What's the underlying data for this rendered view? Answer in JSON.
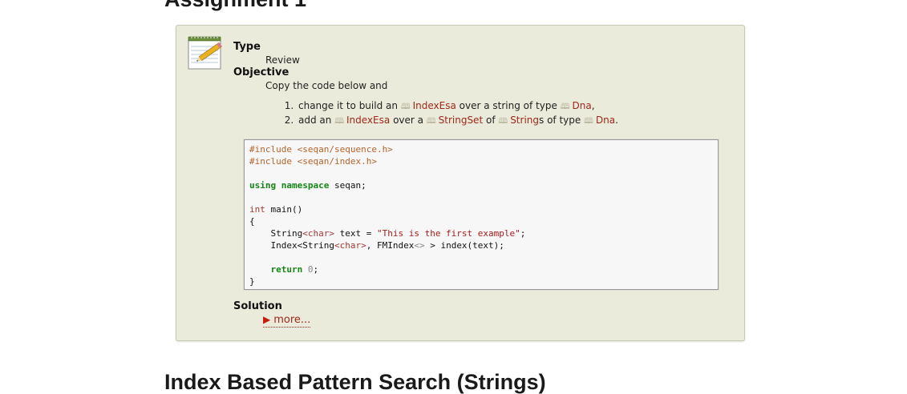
{
  "page": {
    "top_heading": "Assignment 1",
    "bottom_heading": "Index Based Pattern Search (Strings)"
  },
  "assignment": {
    "type_label": "Type",
    "type_value": "Review",
    "objective_label": "Objective",
    "objective_text": "Copy the code below and",
    "items": [
      {
        "t1": "change it to build an",
        "ref1": "IndexEsa",
        "t2": "over a string of type",
        "ref2": "Dna",
        "t3": ","
      },
      {
        "t1": "add an",
        "ref1": "IndexEsa",
        "t2": "over a",
        "ref2": "StringSet",
        "t3": "of",
        "ref3": "String",
        "t4": "s of type",
        "ref4": "Dna",
        "t5": "."
      }
    ],
    "solution_label": "Solution",
    "more_label": "more..."
  },
  "code": {
    "include1": "#include <seqan/sequence.h>",
    "include2": "#include <seqan/index.h>",
    "using_kw": "using namespace",
    "using_rest": " seqan;",
    "int_kw": "int",
    "main_sig": " main()",
    "brace_open": "{",
    "l1_a": "    String",
    "l1_b": "<char>",
    "l1_c": " text = ",
    "l1_str": "\"This is the first example\"",
    "l1_end": ";",
    "l2_a": "    Index<String",
    "l2_b": "<char>",
    "l2_c": ", FMIndex",
    "l2_d": "<>",
    "l2_e": " > index(text);",
    "return_indent": "    ",
    "return_kw": "return",
    "return_num": "0",
    "return_end": ";",
    "brace_close": "}"
  },
  "icons": {
    "notepad": "notepad-pencil-icon",
    "book": "book-icon",
    "triangle": "triangle-right-icon"
  },
  "colors": {
    "box_bg": "#ebebdb",
    "link": "#a0271b",
    "keyword": "#168516",
    "preprocessor": "#b5642a"
  }
}
